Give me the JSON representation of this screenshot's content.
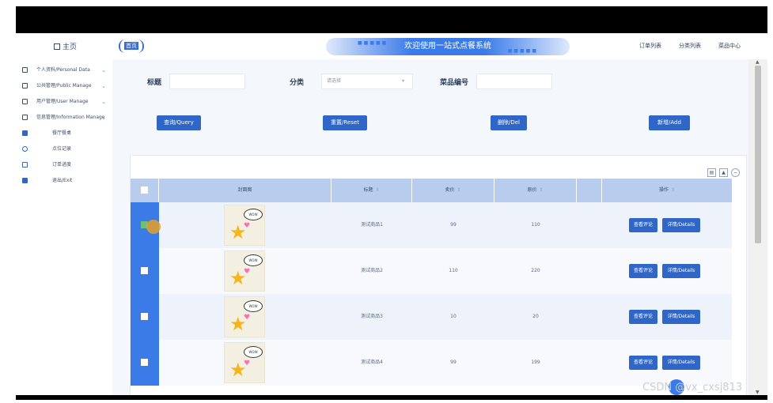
{
  "header": {
    "home": "主页",
    "tag_home": "首页",
    "banner_title": "欢迎使用一站式点餐系统",
    "nav": [
      "订单列表",
      "分类列表",
      "菜品中心"
    ]
  },
  "sidebar": {
    "items": [
      {
        "label": "个人资料/Personal Data",
        "chevron": "⌄"
      },
      {
        "label": "公共管理/Public Manage",
        "chevron": "⌄"
      },
      {
        "label": "用户管理/User Manage",
        "chevron": "⌄"
      },
      {
        "label": "信息管理/Information Manage",
        "chevron": "⌄"
      },
      {
        "label": "餐厅餐桌",
        "chevron": ""
      },
      {
        "label": "点位记录",
        "chevron": ""
      },
      {
        "label": "订单进度",
        "chevron": ""
      },
      {
        "label": "退出/Exit",
        "chevron": ""
      }
    ]
  },
  "filters": {
    "title_label": "标题",
    "title_value": "",
    "category_label": "分类",
    "category_placeholder": "请选择",
    "dish_no_label": "菜品编号",
    "dish_no_value": ""
  },
  "actions": {
    "query": "查询/Query",
    "reset": "重置/Reset",
    "delete": "删除/Del",
    "add": "新增/Add"
  },
  "table": {
    "columns": [
      "",
      "封面图",
      "标题",
      "卖价",
      "原价",
      "",
      "操作"
    ],
    "rows": [
      {
        "checked": true,
        "title": "测试商品1",
        "price": "99",
        "original_price": "110",
        "view_btn": "查看评论",
        "detail_btn": "详情/Details",
        "bubble": "WOW"
      },
      {
        "checked": false,
        "title": "测试商品2",
        "price": "110",
        "original_price": "220",
        "view_btn": "查看评论",
        "detail_btn": "详情/Details",
        "bubble": "WOW"
      },
      {
        "checked": false,
        "title": "测试商品3",
        "price": "10",
        "original_price": "20",
        "view_btn": "查看评论",
        "detail_btn": "详情/Details",
        "bubble": "WOW"
      },
      {
        "checked": false,
        "title": "测试商品4",
        "price": "99",
        "original_price": "199",
        "view_btn": "查看评论",
        "detail_btn": "详情/Details",
        "bubble": "WOW"
      }
    ]
  },
  "watermark": "CSDN @vx_cxsj813",
  "colors": {
    "primary": "#2f66c8",
    "header_row": "#b8cdee",
    "accent": "#3b7be8"
  },
  "icons": {
    "tool1": "print-icon",
    "tool2": "export-icon",
    "tool3": "minus-circle-icon"
  }
}
